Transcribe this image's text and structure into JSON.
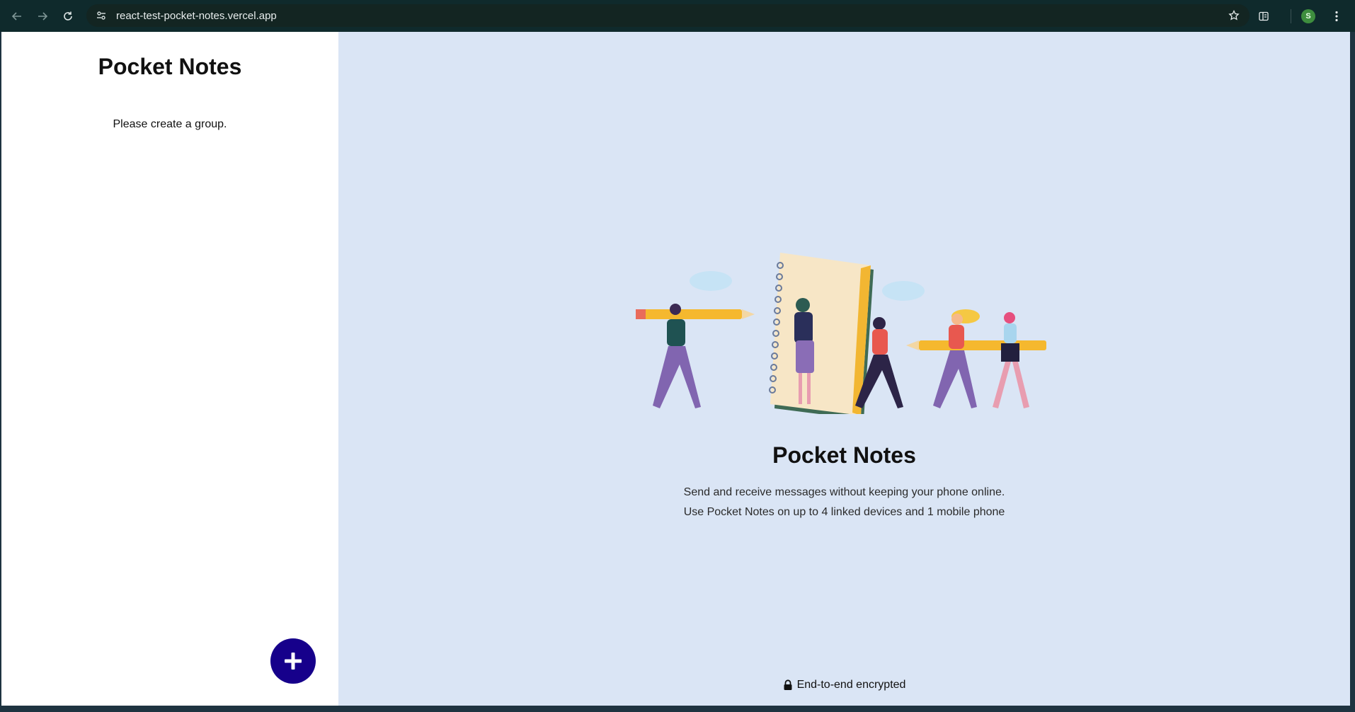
{
  "browser": {
    "url": "react-test-pocket-notes.vercel.app",
    "avatar_letter": "S",
    "icons": [
      "back-arrow-icon",
      "forward-arrow-icon",
      "reload-icon",
      "site-info-icon",
      "star-icon",
      "reading-list-icon",
      "kebab-menu-icon"
    ]
  },
  "sidebar": {
    "title": "Pocket Notes",
    "empty_message": "Please create a group.",
    "fab_icon": "plus-icon",
    "fab_color": "#16008b"
  },
  "main": {
    "title": "Pocket Notes",
    "description_line1": "Send and receive messages without keeping your phone online.",
    "description_line2": "Use Pocket Notes on up to 4 linked devices and 1 mobile phone",
    "footer_text": "End-to-end encrypted",
    "footer_icon": "lock-icon",
    "background": "#dae5f5"
  }
}
